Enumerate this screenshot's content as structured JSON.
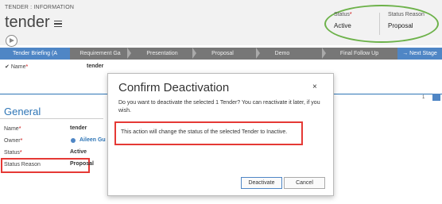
{
  "header": {
    "breadcrumb": "TENDER : INFORMATION",
    "title": "tender",
    "status_label": "Status",
    "status_value": "Active",
    "status_reason_label": "Status Reason",
    "status_reason_value": "Proposal"
  },
  "stages": [
    "Tender Briefing (A",
    "Requirement Ga",
    "Presentation",
    "Proposal",
    "Demo",
    "Final Follow Up"
  ],
  "next_stage": "Next Stage",
  "top_field": {
    "label": "Name",
    "value": "tender"
  },
  "pager": "1",
  "section_title": "General",
  "fields": {
    "name_label": "Name",
    "name_value": "tender",
    "owner_label": "Owner",
    "owner_value": "Aileen Gu",
    "status_label": "Status",
    "status_value": "Active",
    "reason_label": "Status Reason",
    "reason_value": "Proposal"
  },
  "dialog": {
    "title": "Confirm Deactivation",
    "close": "×",
    "message": "Do you want to deactivate the selected 1 Tender? You can reactivate it later, if you wish.",
    "note": "This action will change the status of the selected Tender to Inactive.",
    "deactivate": "Deactivate",
    "cancel": "Cancel"
  },
  "colors": {
    "accent": "#4f86c5",
    "highlight_red": "#e53935",
    "highlight_green": "#6db24a"
  }
}
